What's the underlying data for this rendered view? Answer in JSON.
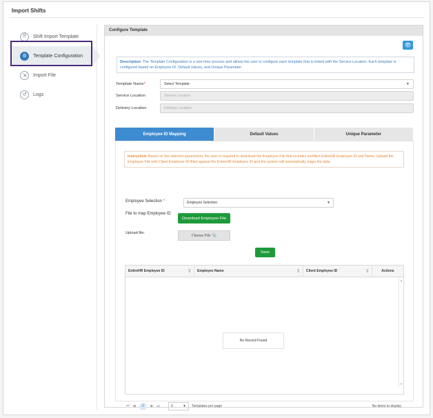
{
  "app": {
    "title": "Import Shifts"
  },
  "sidebar": {
    "items": [
      {
        "label": "Shift Import Template",
        "icon": "document-icon",
        "glyph": "🗎"
      },
      {
        "label": "Template Configuration",
        "icon": "gears-icon",
        "glyph": "⚙"
      },
      {
        "label": "Import File",
        "icon": "import-icon",
        "glyph": "⇲"
      },
      {
        "label": "Logs",
        "icon": "history-icon",
        "glyph": "↺"
      }
    ],
    "active_index": 1
  },
  "panel": {
    "header": "Configure Template",
    "eye_glyph": "👁",
    "description_label": "Description:",
    "description_text": " The Template Configuration is a one-time process and allows the user to configure each template that is linked with the Service Location. Each template is configured based on Employee ID, Default Values, and Unique Parameter.",
    "template_name_label": "Template Name",
    "template_name_value": "Select Template",
    "service_location_label": "Service Location",
    "service_location_placeholder": "Service Location",
    "delivery_location_label": "Delivery Location",
    "delivery_location_placeholder": "Delivery Location",
    "tabs": [
      "Employee ID Mapping",
      "Default Values",
      "Unique Parameter"
    ],
    "active_tab": 0
  },
  "mapping": {
    "instruction_label": "Instruction:",
    "instruction_text": " Based on the selected parameters, the user is required to download the Employee File that includes prefilled EntireHR Employee ID and Name. Upload the Employee File with Client Employee ID filled against the EntireHR Employee ID and the system will automatically maps the data.",
    "employee_selection_label": "Employee Selection",
    "employee_selection_value": "Employee Selection",
    "file_map_label": "File to map Employee ID",
    "download_button": "Download Employee File",
    "upload_label": "Upload file:",
    "choose_file": "Choose File",
    "save_button": "Save"
  },
  "grid": {
    "columns": [
      "EntireHR Employee ID",
      "Employee Name",
      "Client Employee ID",
      "Actions"
    ],
    "empty_text": "No Record Found"
  },
  "pager": {
    "current_page": "0",
    "page_size": "0",
    "per_page_label": "Templates per page",
    "info": "No items to display"
  },
  "colors": {
    "accent": "#3d8bd0",
    "success": "#1d9a3a",
    "highlight": "#4b2a7a",
    "instruction": "#e28a3a"
  }
}
